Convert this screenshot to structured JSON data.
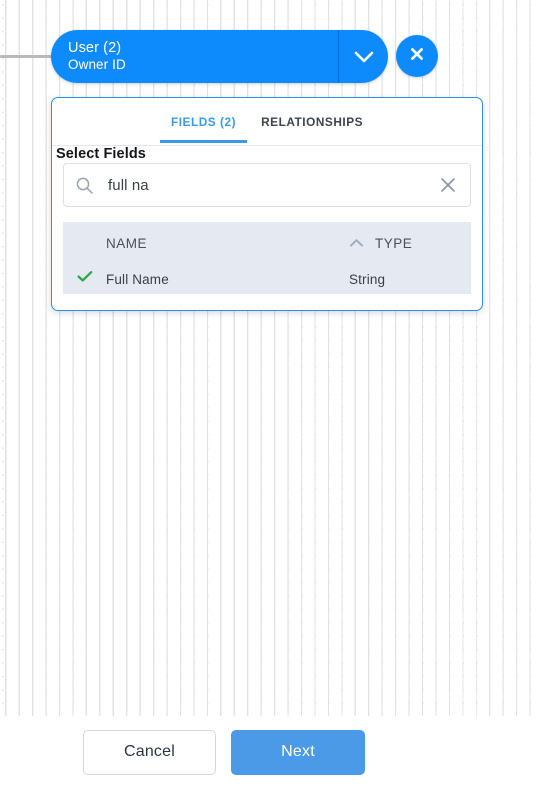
{
  "canvas": {
    "background_color": "#ffffff",
    "dot_color": "#e2e2e2",
    "connector_color": "#b9babc"
  },
  "node": {
    "title": "User (2)",
    "subtitle": "Owner ID",
    "color": "#0d8bfd",
    "divider_color": "#0a6fcc",
    "caret_icon": "chevron-down-icon",
    "close_icon": "close-icon",
    "close_label": "Remove node"
  },
  "panel": {
    "border_color": "#2f8fe0",
    "tabs": [
      {
        "label": "FIELDS (2)",
        "name": "tab-fields",
        "active": true
      },
      {
        "label": "RELATIONSHIPS",
        "name": "tab-relationships",
        "active": false
      }
    ],
    "active_tab_color": "#3c9ae8",
    "section_label": "Select Fields",
    "search": {
      "value": "full na",
      "placeholder": "Search fields",
      "search_icon": "search-icon",
      "clear_icon": "clear-icon"
    },
    "table": {
      "background_color": "#e5eaf2",
      "sort_icon": "sort-ascending-caret-icon",
      "sort_column": "TYPE",
      "columns": [
        {
          "label": "NAME",
          "key": "name"
        },
        {
          "label": "TYPE",
          "key": "type"
        }
      ],
      "rows": [
        {
          "name": "Full Name",
          "type": "String",
          "selected": true,
          "check_icon": "check-icon",
          "check_color": "#2aa84a"
        }
      ]
    }
  },
  "footer": {
    "cancel_label": "Cancel",
    "next_label": "Next",
    "next_color": "#4a9ae8"
  }
}
